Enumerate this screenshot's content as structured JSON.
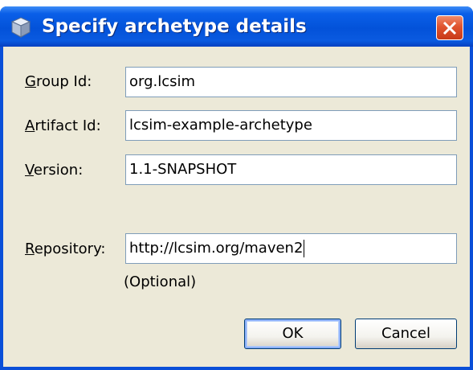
{
  "dialog": {
    "title": "Specify archetype details",
    "icon": "archetype-cube-icon",
    "close_icon": "close-x-icon"
  },
  "fields": {
    "group_id": {
      "label_mnemonic": "G",
      "label_rest": "roup Id:",
      "value": "org.lcsim"
    },
    "artifact_id": {
      "label_mnemonic": "A",
      "label_rest": "rtifact Id:",
      "value": "lcsim-example-archetype"
    },
    "version": {
      "label_mnemonic": "V",
      "label_rest": "ersion:",
      "value": "1.1-SNAPSHOT"
    },
    "repository": {
      "label_mnemonic": "R",
      "label_rest": "epository:",
      "value": "http://lcsim.org/maven2",
      "hint": "(Optional)"
    }
  },
  "buttons": {
    "ok_label": "OK",
    "cancel_label": "Cancel"
  },
  "colors": {
    "titlebar": "#0352d9",
    "client_background": "#ece9d8",
    "close_button": "#e0542f",
    "field_border": "#7f9db9"
  }
}
